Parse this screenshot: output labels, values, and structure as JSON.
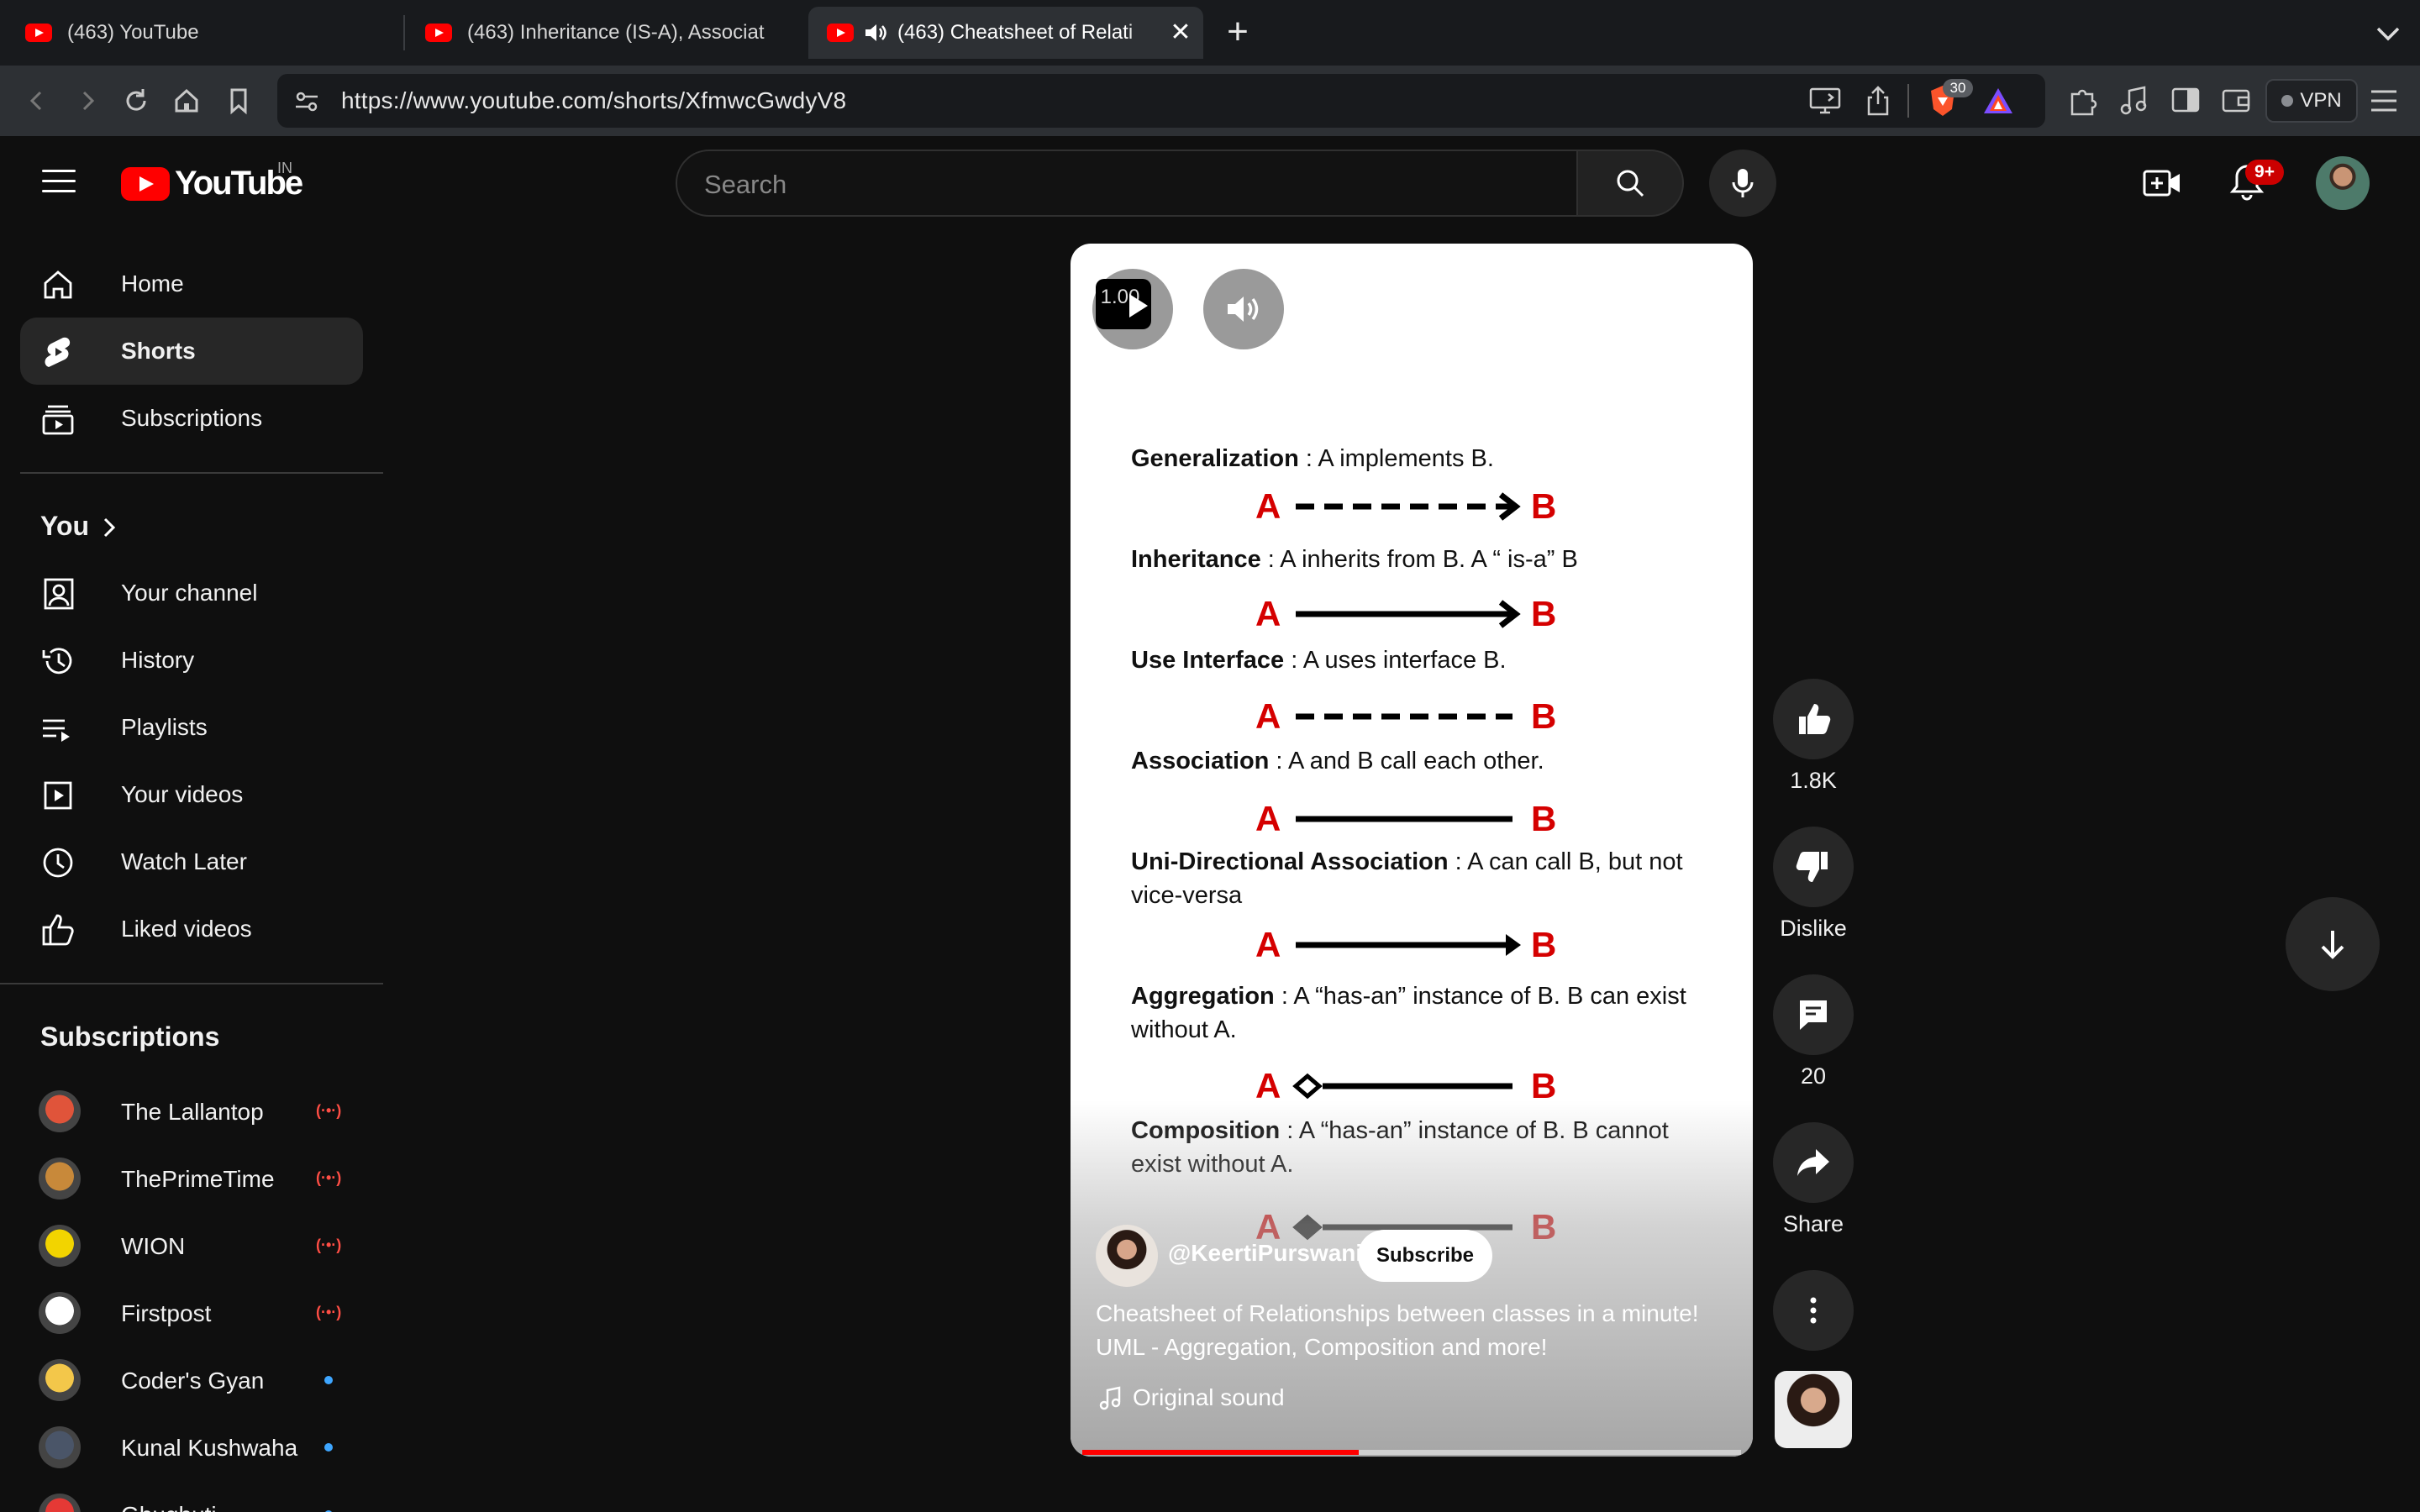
{
  "browser": {
    "tabs": [
      {
        "title": "(463) YouTube"
      },
      {
        "title": "(463) Inheritance (IS-A), Associat"
      },
      {
        "title": "(463) Cheatsheet of Relati"
      }
    ],
    "url": "https://www.youtube.com/shorts/XfmwcGwdyV8",
    "shields_count": "30",
    "vpn_label": "VPN"
  },
  "header": {
    "logo_text": "YouTube",
    "country_code": "IN",
    "search_placeholder": "Search",
    "notification_badge": "9+"
  },
  "sidebar": {
    "main": [
      {
        "label": "Home",
        "icon": "home-icon"
      },
      {
        "label": "Shorts",
        "icon": "shorts-icon"
      },
      {
        "label": "Subscriptions",
        "icon": "subscriptions-icon"
      }
    ],
    "you_title": "You",
    "you_items": [
      {
        "label": "Your channel",
        "icon": "your-channel-icon"
      },
      {
        "label": "History",
        "icon": "history-icon"
      },
      {
        "label": "Playlists",
        "icon": "playlists-icon"
      },
      {
        "label": "Your videos",
        "icon": "your-videos-icon"
      },
      {
        "label": "Watch Later",
        "icon": "watch-later-icon"
      },
      {
        "label": "Liked videos",
        "icon": "liked-videos-icon"
      }
    ],
    "subscriptions_title": "Subscriptions",
    "subscriptions": [
      {
        "name": "The Lallantop",
        "status": "live",
        "color": "#e0543a"
      },
      {
        "name": "ThePrimeTime",
        "status": "live",
        "color": "#c8893a"
      },
      {
        "name": "WION",
        "status": "live",
        "color": "#f2d400"
      },
      {
        "name": "Firstpost",
        "status": "live",
        "color": "#ffffff"
      },
      {
        "name": "Coder's Gyan",
        "status": "new",
        "color": "#f3c74a"
      },
      {
        "name": "Kunal Kushwaha",
        "status": "new",
        "color": "#4a5568"
      },
      {
        "name": "Ghughuti",
        "status": "new",
        "color": "#e53935"
      }
    ]
  },
  "short": {
    "speed_label": "1.00",
    "relationships": [
      {
        "term": "Generalization",
        "desc": " : A implements B.",
        "line": "dashed",
        "head": "arrow"
      },
      {
        "term": "Inheritance",
        "desc": " : A inherits from B. A “ is-a” B",
        "line": "solid",
        "head": "arrow"
      },
      {
        "term": "Use Interface",
        "desc": " : A uses interface B.",
        "line": "dashed",
        "head": "none"
      },
      {
        "term": "Association",
        "desc": " : A and B call each other.",
        "line": "solid",
        "head": "none"
      },
      {
        "term": "Uni-Directional Association",
        "desc": " : A can call B, but not vice-versa",
        "line": "solid",
        "head": "triangle"
      },
      {
        "term": "Aggregation",
        "desc": " : A “has-an” instance of B. B can exist without A.",
        "line": "solid",
        "head": "open-diamond"
      },
      {
        "term": "Composition",
        "desc": " : A “has-an” instance of B. B cannot exist without A.",
        "line": "solid",
        "head": "filled-diamond"
      }
    ],
    "label_a": "A",
    "label_b": "B",
    "channel": "@KeertiPurswani",
    "subscribe_label": "Subscribe",
    "title": "Cheatsheet of Relationships between classes in a minute! UML - Aggregation, Composition and more!",
    "sound": "Original sound",
    "progress": 0.42
  },
  "actions": {
    "likes": "1.8K",
    "dislike_label": "Dislike",
    "comments": "20",
    "share_label": "Share"
  }
}
